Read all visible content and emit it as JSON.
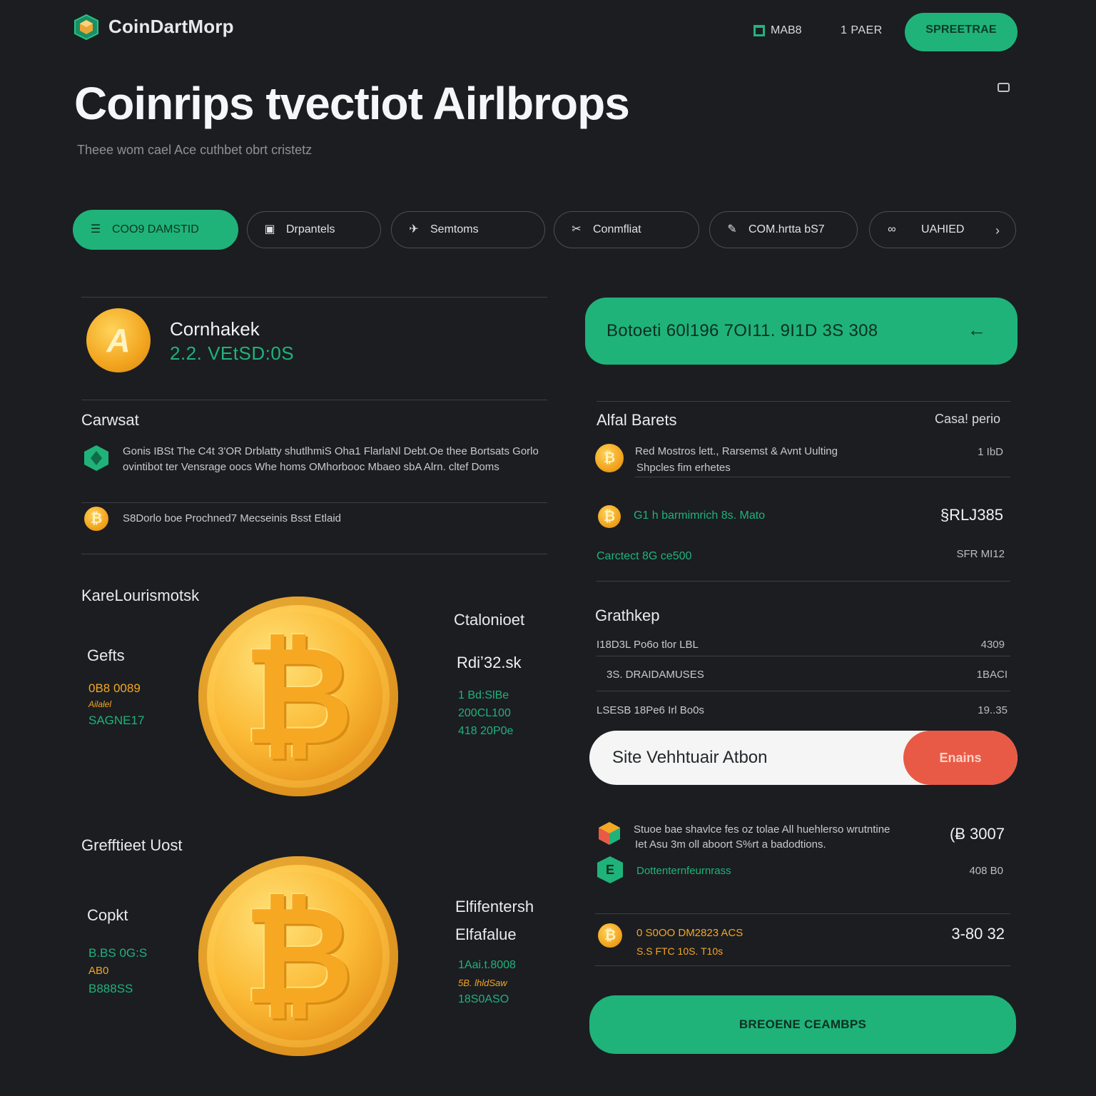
{
  "header": {
    "logo_text": "CoinDartMorp",
    "nav_mab": "MAB8",
    "nav_par": "1 PAER",
    "cta_label": "SPREETRAE"
  },
  "hero": {
    "title": "Coinrips tvectiot Airlbrops",
    "subtitle": "Theee wom cael Ace cuthbet obrt cristetz"
  },
  "tabs": [
    {
      "label": "COO9 DAMSTID",
      "icon": "list-icon"
    },
    {
      "label": "Drpantels",
      "icon": "wallet-icon"
    },
    {
      "label": "Semtoms",
      "icon": "plane-icon"
    },
    {
      "label": "Conmfliat",
      "icon": "scissors-icon"
    },
    {
      "label": "COM.hrtta bS7",
      "icon": "pencil-icon"
    },
    {
      "label": "UAHIED",
      "icon": "link-icon"
    }
  ],
  "token": {
    "name": "Cornhakek",
    "value": "2.2. VEtSD:0S"
  },
  "left": {
    "section1_title": "Carwsat",
    "item1_text": "Gonis IBSt The C4t 3'OR Drblatty shutlhmiS Oha1 FlarlaNl Debt.Oe thee Bortsats Gorlo ovintibot ter Vensrage oocs Whe homs OMhorbooc Mbaeo sbA Alrn. cltef Doms",
    "item2_text": "S8Dorlo boe Prochned7 Mecseinis Bsst Etlaid",
    "section2_title": "KareLourismotsk",
    "stats1": {
      "label": "Gefts",
      "v1": "0B8 0089",
      "v2": "Ailalel",
      "v3": "SAGNE17"
    },
    "side1": {
      "label": "Ctalonioet",
      "value": "Rdiʼ32.sk",
      "v1": "1 Bd:SlBe",
      "v2": "200CL100",
      "v3": "418 20P0e"
    },
    "section3_title": "Grefftieet Uost",
    "stats2": {
      "label": "Copkt",
      "v1": "B.BS 0G:S",
      "v2": "AB0",
      "v3": "B888SS"
    },
    "side2": {
      "label1": "Elfifentersh",
      "label2": "Elfafalue",
      "v1": "1Aai.t.8008",
      "v2": "5B. lhldSaw",
      "v3": "18S0ASO"
    }
  },
  "right": {
    "address": "Botoeti 60l196 7OI11.  9I1D 3S 308",
    "section1_title": "Alfal Barets",
    "section1_right": "Casa! perio",
    "row1_text1": "Red Mostros lett., Rarsemst & Avnt Uulting",
    "row1_text2": "Shpcles fim erhetes",
    "row1_val": "1 IbD",
    "row2_text": "G1 h barmimrich 8s. Mato",
    "row2_val": "§RLJ385",
    "row3_text": "Carctect 8G ce500",
    "row3_val": "SFR MI12",
    "section2_title": "Grathkep",
    "table_rows": [
      {
        "label": "I18D3L Po6o tlor LBL",
        "value": "4309"
      },
      {
        "label": "3S. DRAIDAMUSES",
        "value": "1BACI"
      },
      {
        "label": "LSESB 18Pe6 Irl Bo0s",
        "value": "19..35"
      }
    ],
    "action_label": "Site Vehhtuair Atbon",
    "action_button": "Enains",
    "list1_text1": "Stuoe bae shavlce fes oz tolae All huehlerso wrutntine",
    "list1_text2": "Iet Asu 3m oll aboort S%rt a badodtions.",
    "list1_val": "(Ƀ 3007",
    "list2_text": "Dottenternfeurnrass",
    "list2_val": "408 B0",
    "list3_text1": "0 S0OO DM2823 ACS",
    "list3_text2": "S.S FTC 10S. T10s",
    "list3_val": "3-80 32",
    "bottom_cta": "BREOENE CEAMBPS"
  },
  "colors": {
    "background": "#1b1d21",
    "accent_green": "#1fb37a",
    "accent_orange": "#f5a623",
    "accent_red": "#e85a45"
  }
}
